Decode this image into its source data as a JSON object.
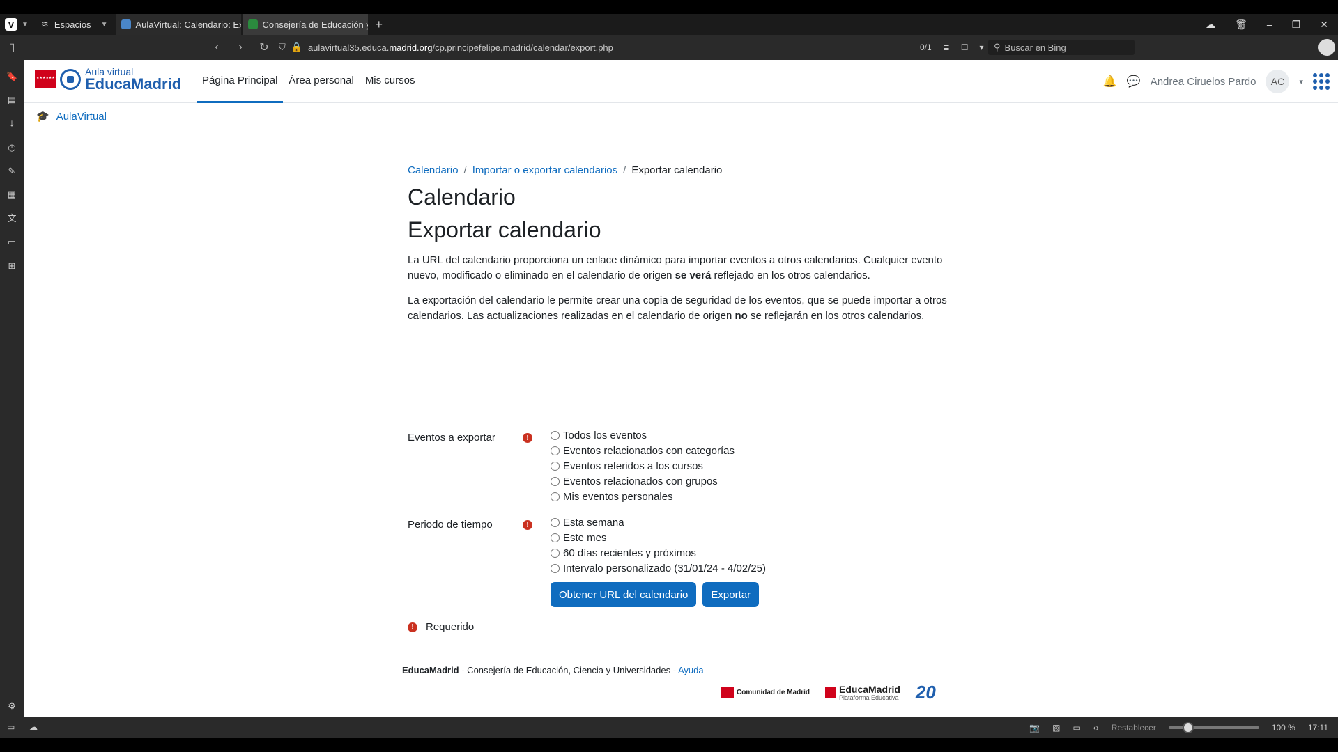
{
  "browser": {
    "spaces_label": "Espacios",
    "tabs": [
      {
        "label": "AulaVirtual: Calendario: Exp"
      },
      {
        "label": "Consejería de Educación y"
      }
    ],
    "url_prefix": "aulavirtual35.educa.",
    "url_domain": "madrid.org",
    "url_suffix": "/cp.principefelipe.madrid/calendar/export.php",
    "reader_count": "0/1",
    "search_placeholder": "Buscar en Bing"
  },
  "statusbar": {
    "reset_label": "Restablecer",
    "zoom": "100 %",
    "time": "17:11"
  },
  "site": {
    "logo_small": "Aula virtual",
    "logo_big": "EducaMadrid",
    "nav": [
      {
        "label": "Página Principal",
        "active": true
      },
      {
        "label": "Área personal"
      },
      {
        "label": "Mis cursos"
      }
    ],
    "user_name": "Andrea Ciruelos Pardo",
    "user_initials": "AC",
    "drawer_link": "AulaVirtual"
  },
  "breadcrumb": [
    {
      "label": "Calendario"
    },
    {
      "label": "Importar o exportar calendarios"
    },
    {
      "label": "Exportar calendario"
    }
  ],
  "title": "Calendario",
  "subtitle": "Exportar calendario",
  "para1": {
    "a": "La URL del calendario proporciona un enlace dinámico para importar eventos a otros calendarios. Cualquier evento nuevo, modificado o eliminado en el calendario de origen ",
    "b": "se verá",
    "c": " reflejado en los otros calendarios."
  },
  "para2": {
    "a": "La exportación del calendario le permite crear una copia de seguridad de los eventos, que se puede importar a otros calendarios. Las actualizaciones realizadas en el calendario de origen ",
    "b": "no",
    "c": " se reflejarán en los otros calendarios."
  },
  "form": {
    "events_label": "Eventos a exportar",
    "events_options": [
      "Todos los eventos",
      "Eventos relacionados con categorías",
      "Eventos referidos a los cursos",
      "Eventos relacionados con grupos",
      "Mis eventos personales"
    ],
    "period_label": "Periodo de tiempo",
    "period_options": [
      "Esta semana",
      "Este mes",
      "60 días recientes y próximos",
      "Intervalo personalizado (31/01/24 - 4/02/25)"
    ],
    "btn_url": "Obtener URL del calendario",
    "btn_export": "Exportar",
    "required_label": "Requerido"
  },
  "footer": {
    "org": "EducaMadrid",
    "text": " - Consejería de Educación, Ciencia y Universidades - ",
    "help": "Ayuda",
    "logo_cm": "Comunidad de Madrid",
    "logo_edu": "EducaMadrid",
    "logo_edu_sub": "Plataforma Educativa",
    "logo_20": "20"
  }
}
